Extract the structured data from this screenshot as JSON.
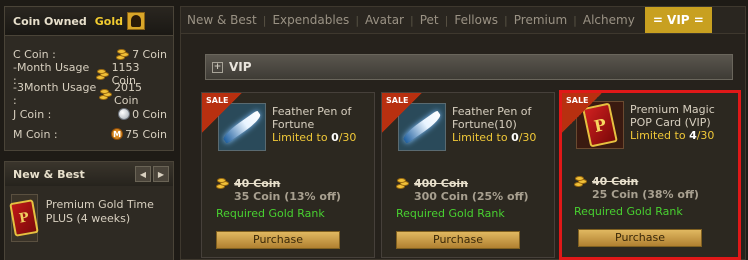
{
  "coin_panel": {
    "title": "Coin Owned",
    "grade": "Gold",
    "rows": [
      {
        "label": "C Coin :",
        "value": "7 Coin",
        "icon": "coin-stack-icon"
      },
      {
        "label": "-Month Usage :",
        "value": "1153 Coin",
        "icon": "coin-stack-icon"
      },
      {
        "label": "-3Month Usage :",
        "value": "2015 Coin",
        "icon": "coin-stack-icon"
      },
      {
        "label": "J Coin :",
        "value": "0 Coin",
        "icon": "j-coin-icon"
      },
      {
        "label": "M Coin :",
        "value": "75 Coin",
        "icon": "m-coin-icon",
        "icon_letter": "M"
      }
    ]
  },
  "new_best": {
    "title": "New & Best",
    "prev": "◀",
    "next": "▶",
    "item_name": "Premium Gold Time PLUS (4 weeks)",
    "card_letter": "P"
  },
  "tabs": [
    {
      "label": "New & Best"
    },
    {
      "label": "Expendables"
    },
    {
      "label": "Avatar"
    },
    {
      "label": "Pet"
    },
    {
      "label": "Fellows"
    },
    {
      "label": "Premium"
    },
    {
      "label": "Alchemy"
    },
    {
      "label": "= VIP =",
      "active": true
    }
  ],
  "section": {
    "plus": "+",
    "title": "VIP"
  },
  "items": [
    {
      "sale": "SALE",
      "name": "Feather Pen of Fortune",
      "limit_prefix": "Limited to ",
      "limit_count": "0",
      "limit_total": "/30",
      "old_price": "40 Coin",
      "new_price": "35 Coin (13% off)",
      "rank": "Required Gold Rank",
      "button": "Purchase"
    },
    {
      "sale": "SALE",
      "name": "Feather Pen of Fortune(10)",
      "limit_prefix": "Limited to ",
      "limit_count": "0",
      "limit_total": "/30",
      "old_price": "400 Coin",
      "new_price": "300 Coin (25% off)",
      "rank": "Required Gold Rank",
      "button": "Purchase"
    },
    {
      "sale": "SALE",
      "name": "Premium Magic POP Card (VIP)",
      "limit_prefix": "Limited to ",
      "limit_count": "4",
      "limit_total": "/30",
      "old_price": "40 Coin",
      "new_price": "25 Coin (38% off)",
      "rank": "Required Gold Rank",
      "button": "Purchase",
      "card_letter": "P",
      "highlight_color": "#e01818"
    }
  ]
}
